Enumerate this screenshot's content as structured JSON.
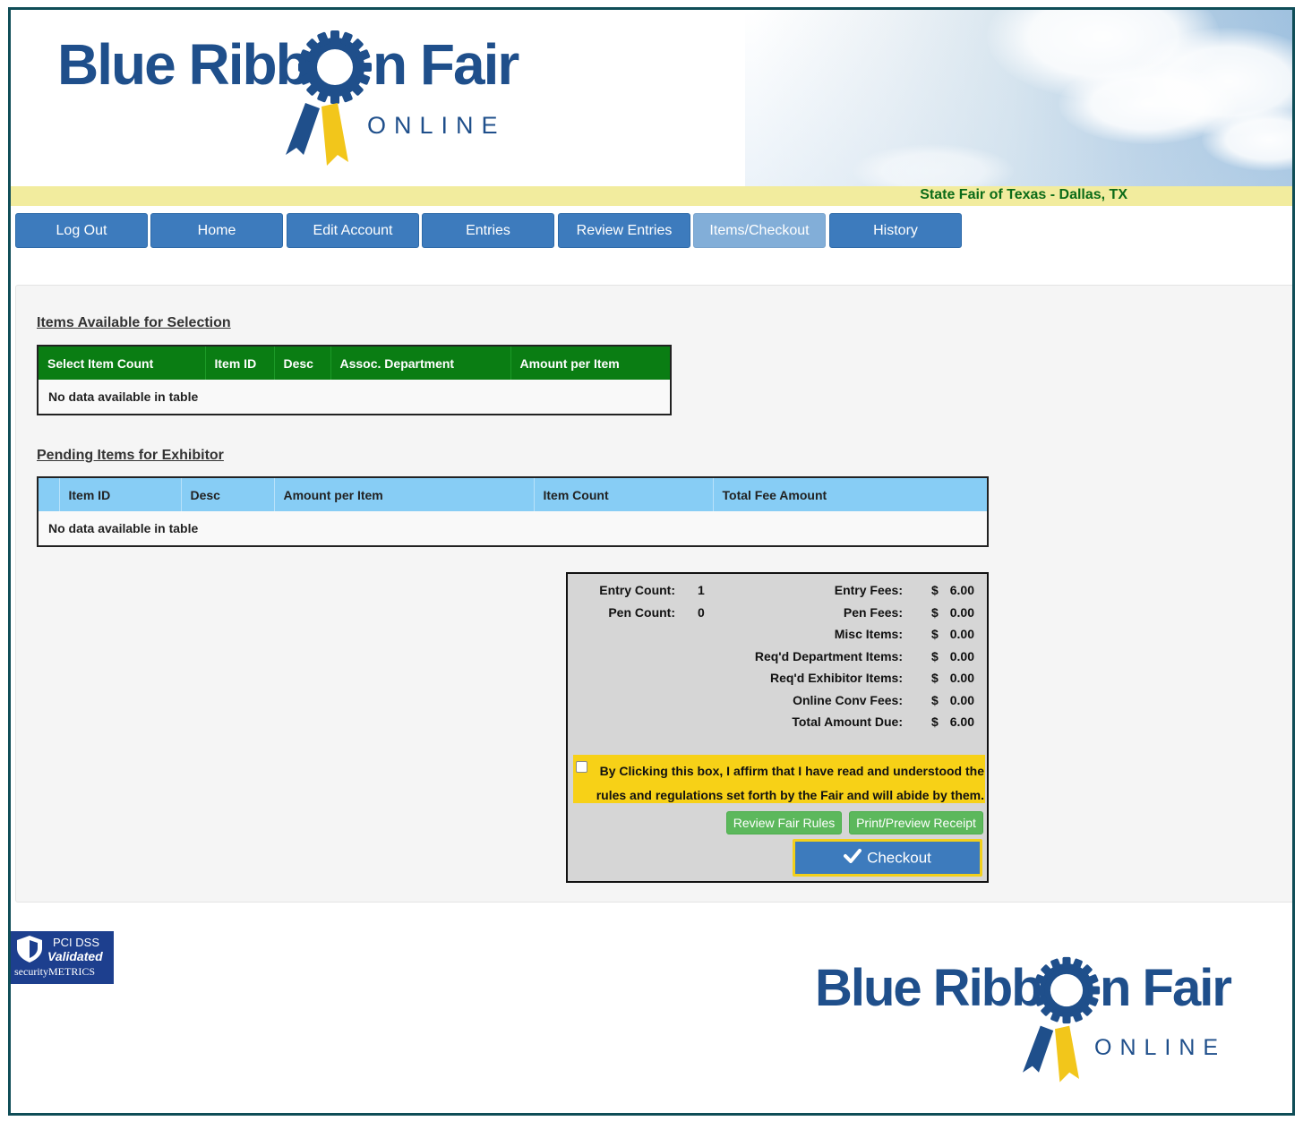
{
  "brand": {
    "name": "Blue Ribbon Fair",
    "word_left": "Blue Ribb",
    "word_right": "n Fair",
    "tagline": "ONLINE"
  },
  "fair_name": "State Fair of Texas - Dallas, TX",
  "nav": [
    {
      "label": "Log Out",
      "active": false
    },
    {
      "label": "Home",
      "active": false
    },
    {
      "label": "Edit Account",
      "active": false
    },
    {
      "label": "Entries",
      "active": false
    },
    {
      "label": "Review Entries",
      "active": false
    },
    {
      "label": "Items/Checkout",
      "active": true
    },
    {
      "label": "History",
      "active": false
    }
  ],
  "items_available": {
    "title": "Items Available for Selection",
    "columns": [
      "Select Item Count",
      "Item ID",
      "Desc",
      "Assoc. Department",
      "Amount per Item"
    ],
    "empty_text": "No data available in table"
  },
  "pending_items": {
    "title": "Pending Items for Exhibitor",
    "columns": [
      "",
      "Item ID",
      "Desc",
      "Amount per Item",
      "Item Count",
      "Total Fee Amount"
    ],
    "empty_text": "No data available in table"
  },
  "summary": {
    "entry_count_label": "Entry Count:",
    "entry_count": "1",
    "pen_count_label": "Pen Count:",
    "pen_count": "0",
    "currency": "$",
    "fees": [
      {
        "label": "Entry Fees:",
        "amount": "6.00"
      },
      {
        "label": "Pen Fees:",
        "amount": "0.00"
      },
      {
        "label": "Misc Items:",
        "amount": "0.00"
      },
      {
        "label": "Req'd Department Items:",
        "amount": "0.00"
      },
      {
        "label": "Req'd Exhibitor Items:",
        "amount": "0.00"
      },
      {
        "label": "Online Conv Fees:",
        "amount": "0.00"
      },
      {
        "label": "Total Amount Due:",
        "amount": "6.00"
      }
    ],
    "affirm_text": "By Clicking this box, I affirm that I have read and understood the rules and regulations set forth by the Fair and will abide by them.",
    "affirm_checked": false,
    "review_rules_label": "Review Fair Rules",
    "print_receipt_label": "Print/Preview Receipt",
    "checkout_label": "Checkout"
  },
  "pci_badge": {
    "line1": "PCI DSS",
    "line2": "Validated",
    "line3": "securityMETRICS"
  },
  "colors": {
    "brand_blue": "#1f4f8b",
    "ribbon_yellow": "#f2c61b",
    "nav_blue": "#3d7bbd",
    "nav_active": "#82aed8",
    "table_green": "#0a7d13",
    "table_blue": "#87cdf5",
    "fair_green": "#0b6b18",
    "affirm_yellow": "#f7d117",
    "button_green": "#5cb85c"
  },
  "icons": {
    "check": "check-icon",
    "gear": "gear-icon",
    "ribbon": "ribbon-icon",
    "shield": "shield-icon"
  }
}
